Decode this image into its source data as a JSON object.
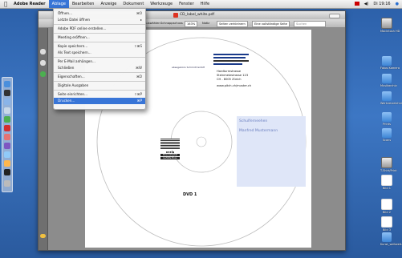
{
  "menubar": {
    "app": "Adobe Reader",
    "items": [
      "Ablage",
      "Bearbeiten",
      "Anzeige",
      "Dokument",
      "Werkzeuge",
      "Fenster",
      "Hilfe"
    ],
    "active_index": 0,
    "clock": "Di 19:16"
  },
  "window": {
    "title": "CD_label_white.pdf",
    "zoom": "163%",
    "find_placeholder": "Suchen",
    "toolbar_labels": [
      "Auswählen",
      "Schnappschuss",
      "Notiz",
      "Seiten verkleinern",
      "Eine vollständige Seite"
    ]
  },
  "file_menu": {
    "items": [
      {
        "label": "Öffnen...",
        "shortcut": "⌘O"
      },
      {
        "label": "Letzte Datei öffnen",
        "shortcut": "▸"
      },
      {
        "sep": true
      },
      {
        "label": "Adobe PDF online erstellen...",
        "shortcut": ""
      },
      {
        "sep": true
      },
      {
        "label": "Meeting eröffnen...",
        "shortcut": ""
      },
      {
        "sep": true
      },
      {
        "label": "Kopie speichern...",
        "shortcut": "⇧⌘S"
      },
      {
        "label": "Als Text speichern...",
        "shortcut": ""
      },
      {
        "sep": true
      },
      {
        "label": "Per E-Mail anhängen...",
        "shortcut": ""
      },
      {
        "label": "Schließen",
        "shortcut": "⌘W"
      },
      {
        "sep": true
      },
      {
        "label": "Eigenschaften...",
        "shortcut": "⌘D"
      },
      {
        "sep": true
      },
      {
        "label": "Digitale Ausgaben",
        "shortcut": ""
      },
      {
        "sep": true
      },
      {
        "label": "Seite einrichten...",
        "shortcut": "⇧⌘P"
      },
      {
        "label": "Drucken...",
        "shortcut": "⌘P",
        "highlighted": true
      }
    ]
  },
  "document": {
    "sender_small": "absagebüro Schmidt GmbH",
    "address": [
      "Hardturmstrasse",
      "Steinmetzstrasse 123",
      "CH - 8005 Zürich"
    ],
    "url": "www.pitch.ch/muster.ch",
    "recipient": [
      "Schulferneehen",
      "Manfred Mustermann"
    ],
    "logo_top": "RHEIN",
    "logo_lines": [
      "Personalpaket",
      "Gefüllte Boxe"
    ],
    "dvd_label": "DVD 1"
  },
  "desktop_icons": [
    {
      "label": "Macintosh HD",
      "type": "drive"
    },
    {
      "label": "Fotos Kamera",
      "type": "folder"
    },
    {
      "label": "Musikarchiv",
      "type": "folder"
    },
    {
      "label": "Werkverzeichnis",
      "type": "folder"
    },
    {
      "label": "Prints",
      "type": "folder"
    },
    {
      "label": "Scans",
      "type": "folder"
    },
    {
      "label": "T-Shirt/Print",
      "type": "drive"
    },
    {
      "label": "Bild 1",
      "type": "doc"
    },
    {
      "label": "Bild 2",
      "type": "doc"
    },
    {
      "label": "Bild 3",
      "type": "doc"
    },
    {
      "label": "Kunst_weltweit.doc",
      "type": "folder"
    }
  ]
}
